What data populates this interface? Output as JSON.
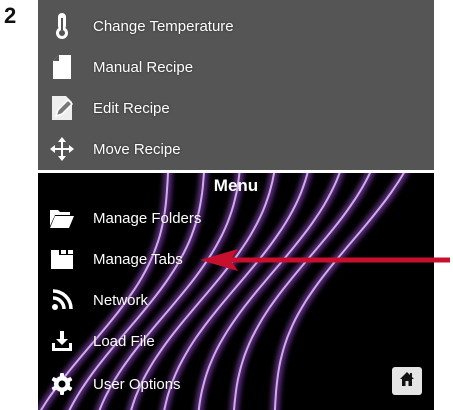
{
  "step_number": "2",
  "colors": {
    "top_background": "#555555",
    "bottom_background": "#000000",
    "wave_color": "#9b4fd6",
    "arrow_color": "#c8102e",
    "text": "#ffffff",
    "home_button_bg": "#e4e4e4"
  },
  "top_items": [
    {
      "label": "Change Temperature",
      "icon": "thermometer-icon"
    },
    {
      "label": "Manual Recipe",
      "icon": "document-icon"
    },
    {
      "label": "Edit Recipe",
      "icon": "edit-pencil-icon"
    },
    {
      "label": "Move Recipe",
      "icon": "move-arrows-icon"
    }
  ],
  "menu": {
    "title": "Menu",
    "items": [
      {
        "label": "Manage Folders",
        "icon": "folder-open-icon"
      },
      {
        "label": "Manage Tabs",
        "icon": "tabs-folder-icon"
      },
      {
        "label": "Network",
        "icon": "network-wifi-icon"
      },
      {
        "label": "Load File",
        "icon": "download-icon"
      },
      {
        "label": "User Options",
        "icon": "gear-icon"
      }
    ]
  },
  "home_button": {
    "icon": "home-icon"
  },
  "annotation": {
    "type": "arrow",
    "points_to": "Manage Tabs"
  }
}
